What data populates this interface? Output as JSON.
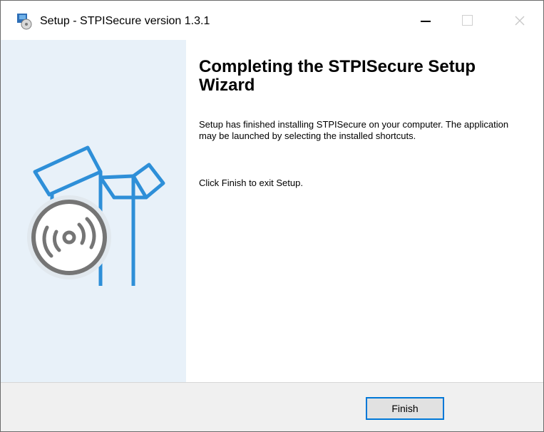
{
  "window": {
    "title": "Setup - STPISecure version 1.3.1",
    "icon": "setup-installer-icon",
    "controls": {
      "minimize": "minimize",
      "maximize": "maximize",
      "close": "close"
    }
  },
  "sidebar": {
    "illustration": "open-box-with-disc",
    "background_color": "#e8f1f9",
    "accent_color": "#2e8fd8"
  },
  "content": {
    "heading": "Completing the STPISecure Setup Wizard",
    "paragraph1": "Setup has finished installing STPISecure on your computer. The application may be launched by selecting the installed shortcuts.",
    "paragraph2": "Click Finish to exit Setup."
  },
  "footer": {
    "finish_label": "Finish"
  }
}
